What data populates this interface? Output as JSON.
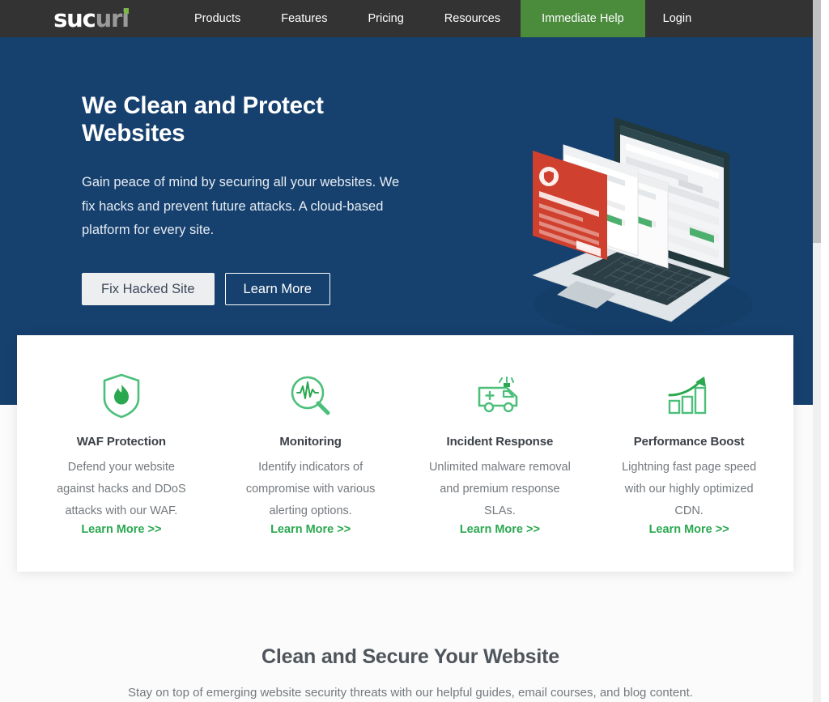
{
  "header": {
    "logo": {
      "part1": "suc",
      "part2": "uri",
      "dot_color": "#7ab648"
    },
    "nav": [
      {
        "label": "Products",
        "style": "plain"
      },
      {
        "label": "Features",
        "style": "plain"
      },
      {
        "label": "Pricing",
        "style": "plain"
      },
      {
        "label": "Resources",
        "style": "plain"
      },
      {
        "label": "Immediate Help",
        "style": "help"
      },
      {
        "label": "Login",
        "style": "login"
      }
    ],
    "background_color": "#333333",
    "help_color": "#4a8b3c"
  },
  "hero": {
    "title": "We Clean and Protect Websites",
    "subtitle": "Gain peace of mind by securing all your websites. We fix hacks and prevent future attacks. A cloud-based platform for every site.",
    "primary_button": "Fix Hacked Site",
    "secondary_button": "Learn More",
    "background_color": "#16406e",
    "illustration": {
      "name": "isometric-laptop-dashboard",
      "alert_panel_color": "#d0402e",
      "laptop_screen_color": "#1f3136"
    }
  },
  "features": {
    "link_color": "#2aa84f",
    "items": [
      {
        "icon": "shield-flame-icon",
        "title": "WAF Protection",
        "description": "Defend your website against hacks and DDoS attacks with our WAF.",
        "link": "Learn More >>"
      },
      {
        "icon": "magnifier-pulse-icon",
        "title": "Monitoring",
        "description": "Identify indicators of compromise with various alerting options.",
        "link": "Learn More >>"
      },
      {
        "icon": "ambulance-icon",
        "title": "Incident Response",
        "description": "Unlimited malware removal and premium response SLAs.",
        "link": "Learn More >>"
      },
      {
        "icon": "growth-chart-icon",
        "title": "Performance Boost",
        "description": "Lightning fast page speed with our highly optimized CDN.",
        "link": "Learn More >>"
      }
    ]
  },
  "bottom": {
    "title": "Clean and Secure Your Website",
    "subtitle": "Stay on top of emerging website security threats with our helpful guides, email courses, and blog content."
  }
}
